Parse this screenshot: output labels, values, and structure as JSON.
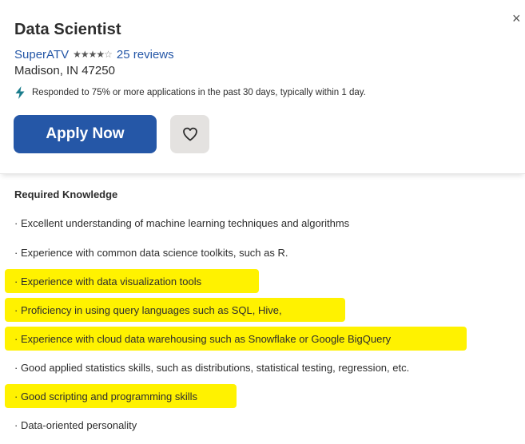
{
  "job": {
    "title": "Data Scientist",
    "company": "SuperATV",
    "rating_stars": 3.5,
    "reviews": "25 reviews",
    "location": "Madison, IN 47250",
    "responded": "Responded to 75% or more applications in the past 30 days, typically within 1 day."
  },
  "actions": {
    "apply_label": "Apply Now",
    "close_glyph": "×"
  },
  "icons": {
    "bolt": "bolt-icon",
    "heart": "heart-icon",
    "close": "close-icon",
    "star": "star-icon"
  },
  "colors": {
    "brand_blue": "#2557a7",
    "highlight": "#fff200",
    "save_button_bg": "#e4e2e0"
  },
  "description": {
    "heading": "Required Knowledge",
    "items": [
      {
        "text": "· Excellent understanding of machine learning techniques and algorithms",
        "highlighted": false
      },
      {
        "text": "· Experience with common data science toolkits, such as R.",
        "highlighted": false
      },
      {
        "text": "· Experience with data visualization tools",
        "highlighted": true
      },
      {
        "text": "· Proficiency in using query languages such as SQL, Hive,",
        "highlighted": true
      },
      {
        "text": "· Experience with cloud data warehousing such as Snowflake or Google BigQuery",
        "highlighted": true
      },
      {
        "text": "· Good applied statistics skills, such as distributions, statistical testing, regression, etc.",
        "highlighted": false
      },
      {
        "text": "· Good scripting and programming skills",
        "highlighted": true
      },
      {
        "text": "· Data-oriented personality",
        "highlighted": false
      }
    ]
  }
}
